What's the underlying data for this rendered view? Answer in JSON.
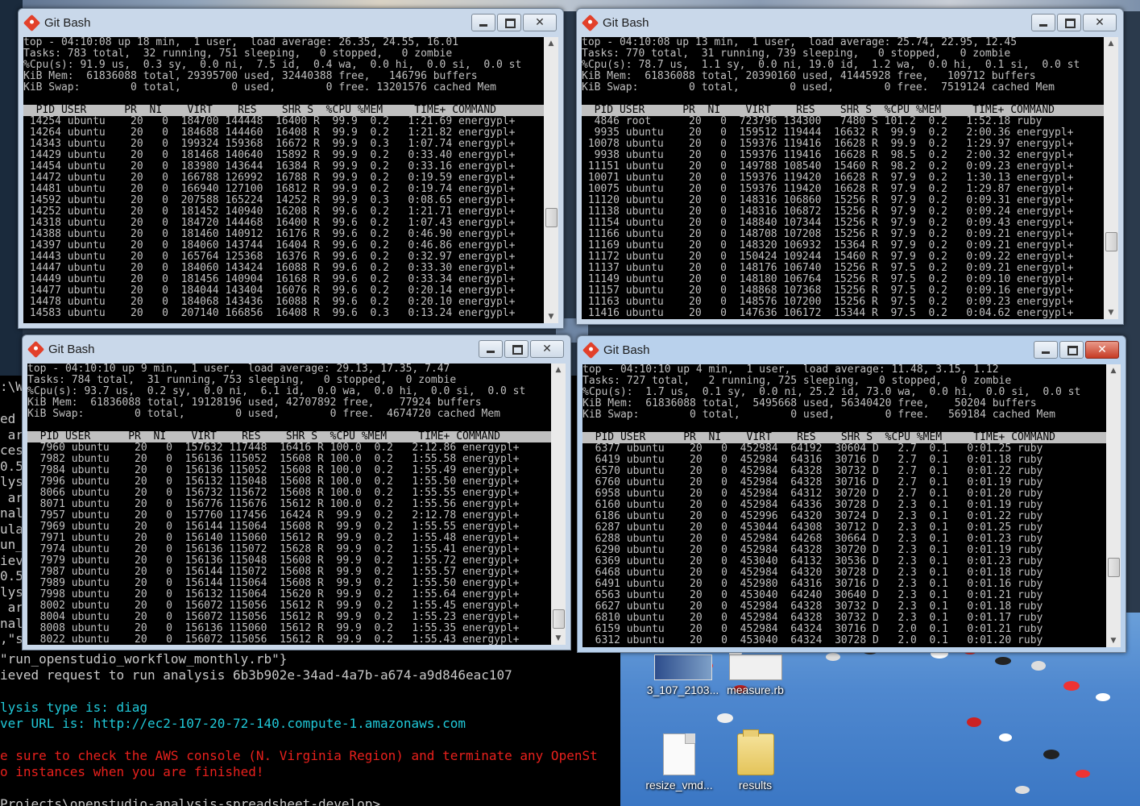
{
  "windows": [
    {
      "title": "Git Bash",
      "summary": [
        "top - 04:10:08 up 18 min,  1 user,  load average: 26.35, 24.55, 16.01",
        "Tasks: 783 total,  32 running, 751 sleeping,   0 stopped,   0 zombie",
        "%Cpu(s): 91.9 us,  0.3 sy,  0.0 ni,  7.5 id,  0.4 wa,  0.0 hi,  0.0 si,  0.0 st",
        "KiB Mem:  61836088 total, 29395700 used, 32440388 free,   146796 buffers",
        "KiB Swap:        0 total,        0 used,        0 free. 13201576 cached Mem"
      ],
      "header": "  PID USER      PR  NI    VIRT    RES    SHR S  %CPU %MEM     TIME+ COMMAND",
      "rows": [
        "14254 ubuntu    20   0  184700 144448  16400 R  99.9  0.2   1:21.69 energypl+",
        "14264 ubuntu    20   0  184688 144460  16408 R  99.9  0.2   1:21.82 energypl+",
        "14343 ubuntu    20   0  199324 159368  16672 R  99.9  0.3   1:07.74 energypl+",
        "14429 ubuntu    20   0  181468 140640  15892 R  99.9  0.2   0:33.40 energypl+",
        "14454 ubuntu    20   0  183980 143644  16384 R  99.9  0.2   0:33.16 energypl+",
        "14472 ubuntu    20   0  166788 126992  16788 R  99.9  0.2   0:19.59 energypl+",
        "14481 ubuntu    20   0  166940 127100  16812 R  99.9  0.2   0:19.74 energypl+",
        "14592 ubuntu    20   0  207588 165224  14252 R  99.9  0.3   0:08.65 energypl+",
        "14252 ubuntu    20   0  181452 140940  16208 R  99.6  0.2   1:21.71 energypl+",
        "14318 ubuntu    20   0  184720 144468  16400 R  99.6  0.2   1:07.43 energypl+",
        "14388 ubuntu    20   0  181460 140912  16176 R  99.6  0.2   0:46.90 energypl+",
        "14397 ubuntu    20   0  184060 143744  16404 R  99.6  0.2   0:46.86 energypl+",
        "14443 ubuntu    20   0  165764 125368  16376 R  99.6  0.2   0:32.97 energypl+",
        "14447 ubuntu    20   0  184060 143424  16088 R  99.6  0.2   0:33.30 energypl+",
        "14449 ubuntu    20   0  181456 140904  16168 R  99.6  0.2   0:33.34 energypl+",
        "14477 ubuntu    20   0  184044 143404  16076 R  99.6  0.2   0:20.14 energypl+",
        "14478 ubuntu    20   0  184068 143436  16088 R  99.6  0.2   0:20.10 energypl+",
        "14583 ubuntu    20   0  207140 166856  16408 R  99.6  0.3   0:13.24 energypl+"
      ]
    },
    {
      "title": "Git Bash",
      "summary": [
        "top - 04:10:08 up 13 min,  1 user,  load average: 25.74, 22.95, 12.45",
        "Tasks: 770 total,  31 running, 739 sleeping,   0 stopped,   0 zombie",
        "%Cpu(s): 78.7 us,  1.1 sy,  0.0 ni, 19.0 id,  1.2 wa,  0.0 hi,  0.1 si,  0.0 st",
        "KiB Mem:  61836088 total, 20390160 used, 41445928 free,   109712 buffers",
        "KiB Swap:        0 total,        0 used,        0 free.  7519124 cached Mem"
      ],
      "header": "  PID USER      PR  NI    VIRT    RES    SHR S  %CPU %MEM     TIME+ COMMAND",
      "rows": [
        " 4846 root      20   0  723796 134300   7480 S 101.2  0.2   1:52.18 ruby",
        " 9935 ubuntu    20   0  159512 119444  16632 R  99.9  0.2   2:00.36 energypl+",
        "10078 ubuntu    20   0  159376 119416  16628 R  99.9  0.2   1:29.97 energypl+",
        " 9938 ubuntu    20   0  159376 119416  16628 R  98.5  0.2   2:00.32 energypl+",
        "11151 ubuntu    20   0  149788 108540  15460 R  98.2  0.2   0:09.23 energypl+",
        "10071 ubuntu    20   0  159376 119420  16628 R  97.9  0.2   1:30.13 energypl+",
        "10075 ubuntu    20   0  159376 119420  16628 R  97.9  0.2   1:29.87 energypl+",
        "11120 ubuntu    20   0  148316 106860  15256 R  97.9  0.2   0:09.31 energypl+",
        "11138 ubuntu    20   0  148316 106872  15256 R  97.9  0.2   0:09.24 energypl+",
        "11154 ubuntu    20   0  148840 107344  15256 R  97.9  0.2   0:09.43 energypl+",
        "11166 ubuntu    20   0  148708 107208  15256 R  97.9  0.2   0:09.21 energypl+",
        "11169 ubuntu    20   0  148320 106932  15364 R  97.9  0.2   0:09.21 energypl+",
        "11172 ubuntu    20   0  150424 109244  15460 R  97.9  0.2   0:09.22 energypl+",
        "11137 ubuntu    20   0  148176 106740  15256 R  97.5  0.2   0:09.21 energypl+",
        "11149 ubuntu    20   0  148180 106764  15256 R  97.5  0.2   0:09.10 energypl+",
        "11157 ubuntu    20   0  148868 107368  15256 R  97.5  0.2   0:09.16 energypl+",
        "11163 ubuntu    20   0  148576 107200  15256 R  97.5  0.2   0:09.23 energypl+",
        "11416 ubuntu    20   0  147636 106172  15344 R  97.5  0.2   0:04.62 energypl+"
      ]
    },
    {
      "title": "Git Bash",
      "summary": [
        "top - 04:10:10 up 9 min,  1 user,  load average: 29.13, 17.35, 7.47",
        "Tasks: 784 total,  31 running, 753 sleeping,   0 stopped,   0 zombie",
        "%Cpu(s): 93.7 us,  0.2 sy,  0.0 ni,  6.1 id,  0.0 wa,  0.0 hi,  0.0 si,  0.0 st",
        "KiB Mem:  61836088 total, 19128196 used, 42707892 free,    77924 buffers",
        "KiB Swap:        0 total,        0 used,        0 free.  4674720 cached Mem"
      ],
      "header": "  PID USER      PR  NI    VIRT    RES    SHR S  %CPU %MEM     TIME+ COMMAND",
      "rows": [
        " 7960 ubuntu    20   0  157632 117448  16416 R 100.0  0.2   2:12.86 energypl+",
        " 7982 ubuntu    20   0  156136 115052  15608 R 100.0  0.2   1:55.58 energypl+",
        " 7984 ubuntu    20   0  156136 115052  15608 R 100.0  0.2   1:55.49 energypl+",
        " 7996 ubuntu    20   0  156132 115048  15608 R 100.0  0.2   1:55.50 energypl+",
        " 8066 ubuntu    20   0  156732 115672  15608 R 100.0  0.2   1:55.55 energypl+",
        " 8071 ubuntu    20   0  156776 115676  15612 R 100.0  0.2   1:55.56 energypl+",
        " 7957 ubuntu    20   0  157760 117456  16424 R  99.9  0.2   2:12.78 energypl+",
        " 7969 ubuntu    20   0  156144 115064  15608 R  99.9  0.2   1:55.55 energypl+",
        " 7971 ubuntu    20   0  156140 115060  15612 R  99.9  0.2   1:55.48 energypl+",
        " 7974 ubuntu    20   0  156136 115072  15628 R  99.9  0.2   1:55.41 energypl+",
        " 7979 ubuntu    20   0  156136 115048  15608 R  99.9  0.2   1:55.72 energypl+",
        " 7987 ubuntu    20   0  156144 115072  15608 R  99.9  0.2   1:55.57 energypl+",
        " 7989 ubuntu    20   0  156144 115064  15608 R  99.9  0.2   1:55.50 energypl+",
        " 7998 ubuntu    20   0  156132 115064  15620 R  99.9  0.2   1:55.64 energypl+",
        " 8002 ubuntu    20   0  156072 115056  15612 R  99.9  0.2   1:55.45 energypl+",
        " 8004 ubuntu    20   0  156072 115056  15612 R  99.9  0.2   1:55.23 energypl+",
        " 8008 ubuntu    20   0  156136 115060  15612 R  99.9  0.2   1:55.35 energypl+",
        " 8022 ubuntu    20   0  156072 115056  15612 R  99.9  0.2   1:55.43 energypl+"
      ]
    },
    {
      "title": "Git Bash",
      "summary": [
        "top - 04:10:10 up 4 min,  1 user,  load average: 11.48, 3.15, 1.12",
        "Tasks: 727 total,   2 running, 725 sleeping,   0 stopped,   0 zombie",
        "%Cpu(s):  1.7 us,  0.1 sy,  0.0 ni, 25.2 id, 73.0 wa,  0.0 hi,  0.0 si,  0.0 st",
        "KiB Mem:  61836088 total,  5495668 used, 56340420 free,    50204 buffers",
        "KiB Swap:        0 total,        0 used,        0 free.   569184 cached Mem"
      ],
      "header": "  PID USER      PR  NI    VIRT    RES    SHR S  %CPU %MEM     TIME+ COMMAND",
      "rows": [
        " 6377 ubuntu    20   0  452984  64192  30604 D   2.7  0.1   0:01.25 ruby",
        " 6419 ubuntu    20   0  452984  64316  30716 D   2.7  0.1   0:01.18 ruby",
        " 6570 ubuntu    20   0  452984  64328  30732 D   2.7  0.1   0:01.22 ruby",
        " 6760 ubuntu    20   0  452984  64328  30716 D   2.7  0.1   0:01.19 ruby",
        " 6958 ubuntu    20   0  452984  64312  30720 D   2.7  0.1   0:01.20 ruby",
        " 6160 ubuntu    20   0  452984  64336  30728 D   2.3  0.1   0:01.19 ruby",
        " 6186 ubuntu    20   0  452996  64320  30724 D   2.3  0.1   0:01.22 ruby",
        " 6287 ubuntu    20   0  453044  64308  30712 D   2.3  0.1   0:01.25 ruby",
        " 6288 ubuntu    20   0  452984  64268  30664 D   2.3  0.1   0:01.23 ruby",
        " 6290 ubuntu    20   0  452984  64328  30720 D   2.3  0.1   0:01.19 ruby",
        " 6369 ubuntu    20   0  453040  64132  30536 D   2.3  0.1   0:01.23 ruby",
        " 6468 ubuntu    20   0  452984  64320  30728 D   2.3  0.1   0:01.18 ruby",
        " 6491 ubuntu    20   0  452980  64316  30716 D   2.3  0.1   0:01.16 ruby",
        " 6563 ubuntu    20   0  453040  64240  30640 D   2.3  0.1   0:01.21 ruby",
        " 6627 ubuntu    20   0  452984  64328  30732 D   2.3  0.1   0:01.18 ruby",
        " 6810 ubuntu    20   0  452984  64328  30732 D   2.3  0.1   0:01.17 ruby",
        " 6159 ubuntu    20   0  452984  64324  30716 D   2.0  0.1   0:01.21 ruby",
        " 6312 ubuntu    20   0  453040  64324  30728 D   2.0  0.1   0:01.20 ruby"
      ]
    }
  ],
  "background_console": {
    "lines": [
      {
        "text": "\"run_openstudio_workflow_monthly.rb\"}",
        "color": "white"
      },
      {
        "text": "ieved request to run analysis 6b3b902e-34ad-4a7b-a674-a9d846eac107",
        "color": "white"
      },
      {
        "text": "",
        "color": "white"
      },
      {
        "text": "lysis type is: diag",
        "color": "cyan"
      },
      {
        "text": "ver URL is: http://ec2-107-20-72-140.compute-1.amazonaws.com",
        "color": "cyan"
      },
      {
        "text": "",
        "color": "white"
      },
      {
        "text": "e sure to check the AWS console (N. Virginia Region) and terminate any OpenSt",
        "color": "red"
      },
      {
        "text": "o instances when you are finished!",
        "color": "red"
      },
      {
        "text": "",
        "color": "white"
      },
      {
        "text": "Projects\\openstudio-analysis-spreadsheet-develop>",
        "color": "white"
      }
    ],
    "left_fragments": [
      "ed",
      " ar",
      "ces",
      "0.5",
      "lys",
      " ar",
      "nal",
      "ula",
      "un_",
      "iev",
      "0.5",
      "lys",
      " ar",
      "nal",
      ",\"s"
    ],
    "tab_fragment": ":\\W"
  },
  "desktop_icons": [
    {
      "label": "3_107_2103...",
      "icon": "thumbnail-icon"
    },
    {
      "label": "measure.rb",
      "icon": "file-icon"
    },
    {
      "label": "resize_vmd...",
      "icon": "file-icon"
    },
    {
      "label": "results",
      "icon": "folder-icon"
    }
  ],
  "colors": {
    "terminal_bg": "#000000",
    "terminal_fg": "#c0c0c0",
    "header_bg": "#c0c0c0",
    "console_cyan": "#20c8d8",
    "console_red": "#e8201c",
    "close_red": "#c63b24"
  }
}
